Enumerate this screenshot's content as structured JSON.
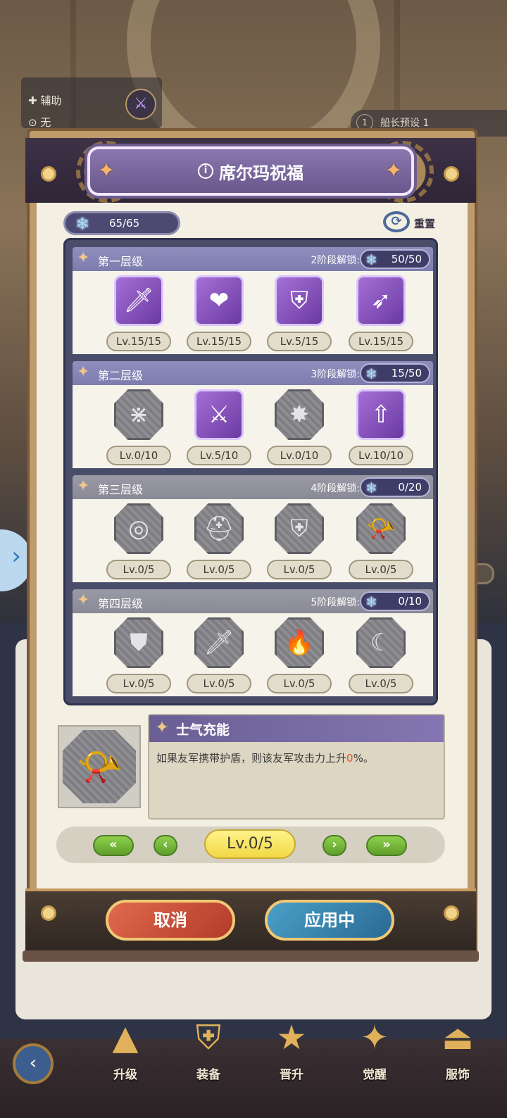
{
  "background": {
    "assist_label": "辅助",
    "none_label": "无",
    "preset_number": "1",
    "preset_label": "船长预设 1"
  },
  "dialog": {
    "title": "席尔玛祝福",
    "points": "65/65",
    "reset_label": "重置"
  },
  "tiers": [
    {
      "name": "第一层级",
      "unlock_label": "2阶段解锁:",
      "unlock_value": "50/50",
      "skills": [
        {
          "icon": "sparkle-sword-icon",
          "glyph": "🗡",
          "level": "Lv.15/15",
          "active": true
        },
        {
          "icon": "heart-shield-icon",
          "glyph": "❤",
          "level": "Lv.15/15",
          "active": true
        },
        {
          "icon": "crest-shield-icon",
          "glyph": "⛨",
          "level": "Lv.5/15",
          "active": true
        },
        {
          "icon": "slash-strike-icon",
          "glyph": "➶",
          "level": "Lv.15/15",
          "active": true
        }
      ]
    },
    {
      "name": "第二层级",
      "unlock_label": "3阶段解锁:",
      "unlock_value": "15/50",
      "skills": [
        {
          "icon": "converge-arrows-icon",
          "glyph": "⋇",
          "level": "Lv.0/10",
          "active": false
        },
        {
          "icon": "flying-sword-icon",
          "glyph": "⚔",
          "level": "Lv.5/10",
          "active": true
        },
        {
          "icon": "burst-star-icon",
          "glyph": "✸",
          "level": "Lv.0/10",
          "active": false
        },
        {
          "icon": "arrow-up-ring-icon",
          "glyph": "⇧",
          "level": "Lv.10/10",
          "active": true
        }
      ]
    },
    {
      "name": "第三层级",
      "unlock_label": "4阶段解锁:",
      "unlock_value": "0/20",
      "skills": [
        {
          "icon": "swirl-orb-icon",
          "glyph": "◎",
          "level": "Lv.0/5",
          "active": false
        },
        {
          "icon": "knight-helmet-icon",
          "glyph": "⛑",
          "level": "Lv.0/5",
          "active": false
        },
        {
          "icon": "laurel-shield-icon",
          "glyph": "⛨",
          "level": "Lv.0/5",
          "active": false
        },
        {
          "icon": "horn-axe-icon",
          "glyph": "📯",
          "level": "Lv.0/5",
          "active": false,
          "selected": true
        }
      ]
    },
    {
      "name": "第四层级",
      "unlock_label": "5阶段解锁:",
      "unlock_value": "0/10",
      "skills": [
        {
          "icon": "wind-shield-icon",
          "glyph": "⛊",
          "level": "Lv.0/5",
          "active": false
        },
        {
          "icon": "dagger-wave-icon",
          "glyph": "🗡",
          "level": "Lv.0/5",
          "active": false
        },
        {
          "icon": "flame-icon",
          "glyph": "🔥",
          "level": "Lv.0/5",
          "active": false
        },
        {
          "icon": "crescent-orbit-icon",
          "glyph": "☾",
          "level": "Lv.0/5",
          "active": false
        }
      ]
    }
  ],
  "detail": {
    "name": "士气充能",
    "desc_before": "如果友军携带护盾，则该友军攻击力上升",
    "desc_pct": "0",
    "desc_after": "%。",
    "icon": "horn-axe-icon"
  },
  "stepper": {
    "min_label": "«",
    "prev_label": "‹",
    "current": "Lv.0/5",
    "next_label": "›",
    "max_label": "»"
  },
  "buttons": {
    "cancel": "取消",
    "apply": "应用中"
  },
  "nav": [
    {
      "label": "升级",
      "icon": "upgrade-icon",
      "glyph": "▲"
    },
    {
      "label": "装备",
      "icon": "equipment-shield-icon",
      "glyph": "⛨"
    },
    {
      "label": "晋升",
      "icon": "promote-star-icon",
      "glyph": "★"
    },
    {
      "label": "觉醒",
      "icon": "awaken-star-icon",
      "glyph": "✦"
    },
    {
      "label": "服饰",
      "icon": "outfit-hanger-icon",
      "glyph": "⏏"
    }
  ],
  "colors": {
    "accent_purple": "#7d7cae",
    "progress_green": "#5f9e2b",
    "cancel_red": "#b33a2a",
    "apply_blue": "#2a6a94",
    "highlight_orange": "#e0532f"
  }
}
